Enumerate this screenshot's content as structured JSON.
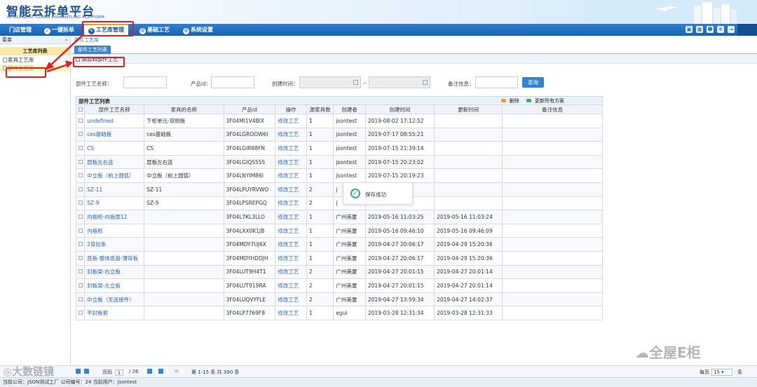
{
  "app": {
    "title": "智能云拆单平台",
    "subtitle": "INTELLIGENT CLOUD DISMANTLING PLATFORM"
  },
  "nav": {
    "items": [
      {
        "label": "门店管理",
        "icon": "store-icon"
      },
      {
        "label": "一键拆单",
        "icon": "check-icon"
      },
      {
        "label": "工艺库管理",
        "icon": "wrench-icon",
        "active": true
      },
      {
        "label": "基础工艺",
        "icon": "settings-icon"
      },
      {
        "label": "系统设置",
        "icon": "gear-icon"
      }
    ],
    "tools": [
      "monitor-icon",
      "calendar-icon",
      "user-icon",
      "gear-icon",
      "logout-icon"
    ]
  },
  "sidebar": {
    "header": "菜单",
    "collapse": "«",
    "section": "工艺库列表",
    "items": [
      {
        "label": "家具工艺库"
      },
      {
        "label": "部件工艺库",
        "selected": true
      }
    ]
  },
  "main": {
    "breadcrumb": "部件工艺库",
    "tab": "部件工艺列表",
    "add_button": "添加到部件工艺",
    "search": {
      "name_label": "部件工艺名称：",
      "product_label": "产品id：",
      "created_label": "创建时间：",
      "dash": "--",
      "remark_label": "备注信息：",
      "query_button": "查询"
    },
    "list": {
      "title": "部件工艺列表",
      "delete": "删除",
      "update_all": "更新所有方案",
      "columns": [
        "",
        "部件工艺名称",
        "家具的名称",
        "产品id",
        "操作",
        "源家具数",
        "创建者",
        "创建时间",
        "更新时间",
        "备注信息"
      ],
      "rows": [
        [
          "undefined",
          "下柜单元-双侧板",
          "3F04MI1V4BIX",
          "修改工艺",
          "1",
          "jsontest",
          "2019-08-02 17:12:52",
          "",
          ""
        ],
        [
          "ces基础板",
          "ces基础板",
          "3F04LGROOW6I",
          "修改工艺",
          "1",
          "jsontest",
          "2019-07-17 08:55:21",
          "",
          ""
        ],
        [
          "CS",
          "CS",
          "3F04LGIR88FN",
          "修改工艺",
          "1",
          "jsontest",
          "2019-07-15 21:39:14",
          "",
          ""
        ],
        [
          "层板左右连",
          "层板左右连",
          "3F04LGIQS555",
          "修改工艺",
          "1",
          "jsontest",
          "2019-07-15 20:23:02",
          "",
          ""
        ],
        [
          "中立板（前上圆弧）",
          "中立板（前上圆弧）",
          "3F04LNYIM86I",
          "修改工艺",
          "1",
          "jsontest",
          "2019-07-15 20:19:23",
          "",
          ""
        ],
        [
          "SZ-11",
          "SZ-11",
          "3F04LPUYRVWO",
          "修改工艺",
          "2",
          "j",
          ":45:16",
          "",
          ""
        ],
        [
          "SZ-9",
          "SZ-9",
          "3F04LPSREPGQ",
          "修改工艺",
          "2",
          "j",
          ":45:15",
          "",
          ""
        ],
        [
          "内格柜-内板厚12",
          "",
          "3F04L7KL3LLO",
          "修改工艺",
          "1",
          "广州美厦",
          "2019-05-16 11:03:25",
          "2019-05-16 11:03:24",
          ""
        ],
        [
          "内格柜",
          "",
          "3F04LXX0K1JB",
          "修改工艺",
          "1",
          "广州美厦",
          "2019-05-16 09:46:10",
          "2019-05-16 09:46:09",
          ""
        ],
        [
          "2背拉条",
          "",
          "3F04MDY7UJ6X",
          "修改工艺",
          "1",
          "广州美厦",
          "2019-04-27 20:06:17",
          "2019-04-29 15:20:36",
          ""
        ],
        [
          "底板-整体底盘-薄背板",
          "",
          "3F04MDYHDDJH",
          "修改工艺",
          "1",
          "广州美厦",
          "2019-04-27 20:06:17",
          "2019-04-29 15:20:36",
          ""
        ],
        [
          "封板架-右立板",
          "",
          "3F04LUT9H4T1",
          "修改工艺",
          "2",
          "广州美厦",
          "2019-04-27 20:01:15",
          "2019-04-27 20:01:14",
          ""
        ],
        [
          "封板架-左立板",
          "",
          "3F04LUT919RA",
          "修改工艺",
          "2",
          "广州美厦",
          "2019-04-27 20:01:15",
          "2019-04-27 20:01:14",
          ""
        ],
        [
          "中立板（无连接件）",
          "",
          "3F04LUQVYFLE",
          "修改工艺",
          "2",
          "广州美厦",
          "2019-04-27 13:59:34",
          "2019-04-27 14:02:37",
          ""
        ],
        [
          "平封板框",
          "",
          "3F04LP7769F8",
          "修改工艺",
          "1",
          "egui",
          "2019-03-28 12:31:34",
          "2019-03-28 12:31:33",
          ""
        ]
      ]
    },
    "toast": "保存成功"
  },
  "pager": {
    "page_label": "页码",
    "current_page": "1",
    "total_pages": "/ 26",
    "summary": "第 1-15 条  共 390 条",
    "per_page_label": "每页",
    "per_page_value": "15",
    "unit": "条"
  },
  "status": {
    "text": "当前公司：JSON测试工厂    公司编号：24    当前用户：jsontest"
  },
  "watermarks": {
    "left": "大数链镜",
    "right": "全屋E柜"
  },
  "colors": {
    "nav": "#1762b3",
    "link": "#2563c4",
    "highlight": "#e02020",
    "accent": "#2f84d6"
  }
}
